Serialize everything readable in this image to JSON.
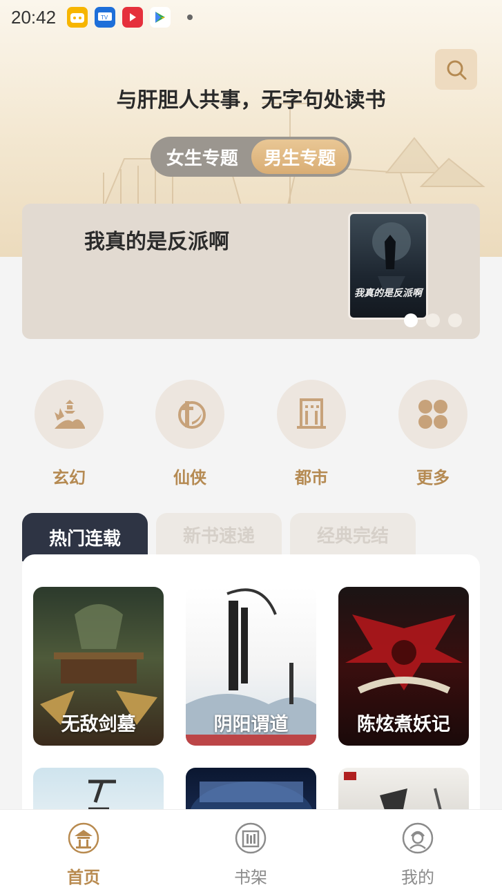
{
  "status_bar": {
    "time": "20:42",
    "icons": [
      "bilibili-app-icon",
      "tv-app-icon",
      "video-app-icon",
      "play-store-icon"
    ]
  },
  "header": {
    "slogan": "与肝胆人共事，无字句处读书",
    "search_icon": "search-icon"
  },
  "gender_tabs": [
    {
      "label": "女生专题",
      "active": false
    },
    {
      "label": "男生专题",
      "active": true
    }
  ],
  "banner": {
    "title": "我真的是反派啊",
    "cover_text": "我真的是反派啊",
    "page_count": 3,
    "active_page": 1
  },
  "categories": [
    {
      "label": "玄幻",
      "icon": "pagoda-mountain-icon"
    },
    {
      "label": "仙侠",
      "icon": "sword-icon"
    },
    {
      "label": "都市",
      "icon": "building-icon"
    },
    {
      "label": "更多",
      "icon": "grid-more-icon"
    }
  ],
  "list_tabs": [
    {
      "label": "热门连载",
      "active": true
    },
    {
      "label": "新书速递",
      "active": false
    },
    {
      "label": "经典完结",
      "active": false
    }
  ],
  "books": [
    {
      "title": "无敌剑墓"
    },
    {
      "title": "阴阳谓道"
    },
    {
      "title": "陈炫煮妖记"
    },
    {
      "title": ""
    },
    {
      "title": ""
    },
    {
      "title": ""
    }
  ],
  "bottom_nav": [
    {
      "label": "首页",
      "icon": "home-pavilion-icon",
      "active": true
    },
    {
      "label": "书架",
      "icon": "bookshelf-icon",
      "active": false
    },
    {
      "label": "我的",
      "icon": "profile-icon",
      "active": false
    }
  ],
  "colors": {
    "accent": "#b88a4f",
    "tab_active_bg": "#2e3444",
    "banner_bg": "#e2dad1"
  }
}
